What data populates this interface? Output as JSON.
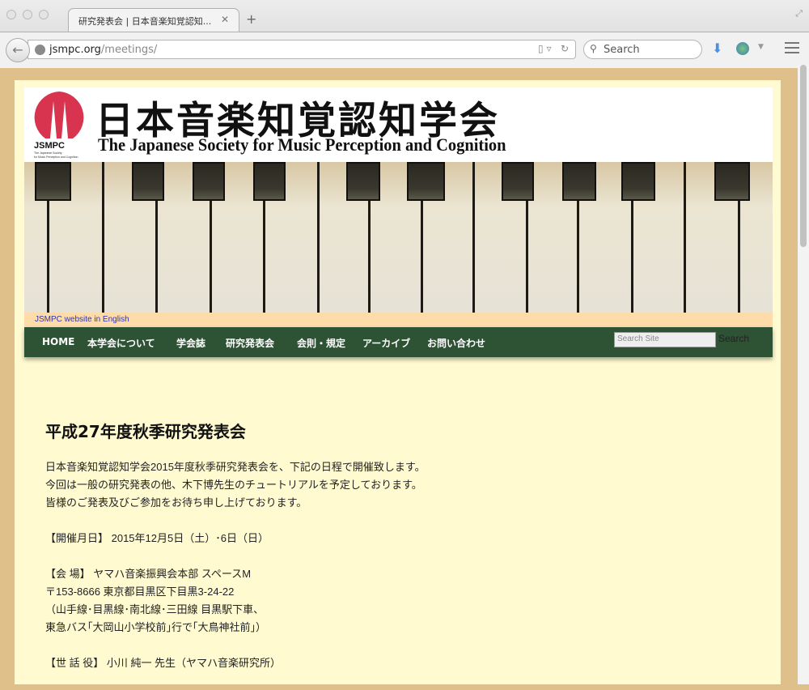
{
  "browser": {
    "tab_title": "研究発表会 | 日本音楽知覚認知...",
    "url_domain": "jsmpc.org",
    "url_path": "/meetings/",
    "search_placeholder": "Search"
  },
  "header": {
    "logo_text": "JSMPC",
    "logo_subtext": "The Japanese Society for Music Perception and Cognition",
    "title_ja": "日本音楽知覚認知学会",
    "title_en": "The Japanese Society for Music Perception and Cognition",
    "english_link": "JSMPC website in English"
  },
  "nav": {
    "items": [
      {
        "label": "HOME"
      },
      {
        "label": "本学会について"
      },
      {
        "label": "学会誌"
      },
      {
        "label": "研究発表会"
      },
      {
        "label": "会則・規定"
      },
      {
        "label": "アーカイブ"
      },
      {
        "label": "お問い合わせ"
      }
    ],
    "search_placeholder": "Search Site",
    "search_button": "Search"
  },
  "content": {
    "title": "平成27年度秋季研究発表会",
    "intro": [
      "日本音楽知覚認知学会2015年度秋季研究発表会を、下記の日程で開催致します。",
      "今回は一般の研究発表の他、木下博先生のチュートリアルを予定しております。",
      "皆様のご発表及びご参加をお待ち申し上げております。"
    ],
    "date": "【開催月日】 2015年12月5日（土）･6日（日）",
    "venue": [
      "【会 場】 ヤマハ音楽振興会本部 スペースM",
      "〒153-8666 東京都目黒区下目黒3-24-22",
      "（山手線･目黒線･南北線･三田線 目黒駅下車、",
      "東急バス｢大岡山小学校前｣行で｢大鳥神社前｣）"
    ],
    "organizer": "【世 話 役】 小川 純一 先生（ヤマハ音楽研究所）"
  },
  "colors": {
    "nav_bg": "#2d5234",
    "page_bg": "#dfc08a",
    "panel_bg": "#fffad0",
    "logo_red": "#d8344f"
  }
}
